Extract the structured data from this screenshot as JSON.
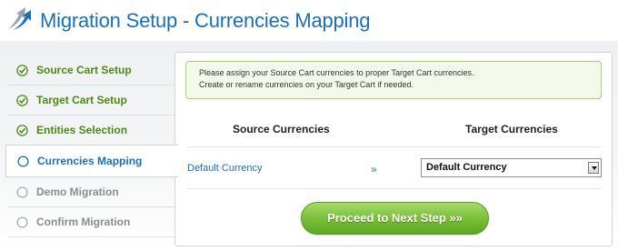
{
  "header": {
    "title": "Migration Setup - Currencies Mapping",
    "logo_icon": "migration-arrow-icon"
  },
  "steps": [
    {
      "label": "Source Cart Setup",
      "status": "done",
      "icon": "check-circle-icon"
    },
    {
      "label": "Target Cart Setup",
      "status": "done",
      "icon": "check-circle-icon"
    },
    {
      "label": "Entities Selection",
      "status": "done",
      "icon": "check-circle-icon"
    },
    {
      "label": "Currencies Mapping",
      "status": "active",
      "icon": "circle-icon"
    },
    {
      "label": "Demo Migration",
      "status": "todo",
      "icon": "circle-icon"
    },
    {
      "label": "Confirm Migration",
      "status": "todo",
      "icon": "circle-icon"
    }
  ],
  "notice": {
    "line1": "Please assign your Source Cart currencies to proper Target Cart currencies.",
    "line2": "Create or rename currencies on your Target Cart if needed."
  },
  "mapping": {
    "source_header": "Source Currencies",
    "target_header": "Target Currencies",
    "rows": [
      {
        "source": "Default Currency",
        "arrow": "»",
        "target": "Default Currency"
      }
    ]
  },
  "proceed_button": "Proceed to Next Step »»",
  "colors": {
    "accent_blue": "#1d6fb4",
    "done_green": "#4a8a14",
    "button_green": "#7cc13a",
    "notice_border": "#9fd36b"
  }
}
